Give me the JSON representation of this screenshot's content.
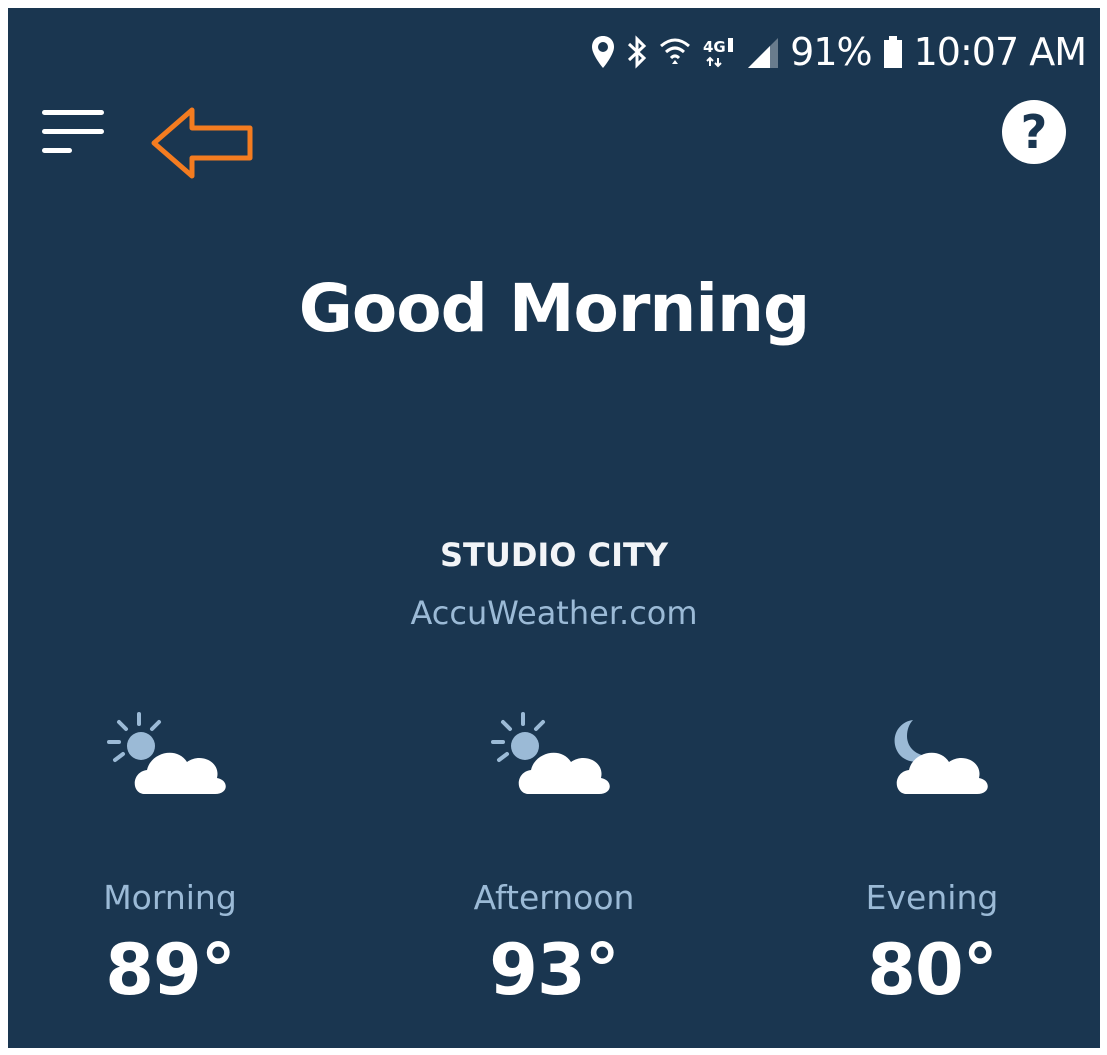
{
  "status_bar": {
    "battery_percent": "91%",
    "time": "10:07 AM",
    "icons": [
      "location-icon",
      "bluetooth-icon",
      "wifi-icon",
      "lte-icon",
      "signal-icon",
      "battery-icon"
    ]
  },
  "header": {
    "menu_icon": "hamburger-menu-icon",
    "help_icon": "help-icon",
    "help_label": "?",
    "annotation_icon": "arrow-left-outline",
    "annotation_color": "#f47c20"
  },
  "greeting": "Good Morning",
  "weather": {
    "location": "STUDIO CITY",
    "source": "AccuWeather.com",
    "forecast": [
      {
        "period": "Morning",
        "temp": "89°",
        "icon": "partly-sunny-icon"
      },
      {
        "period": "Afternoon",
        "temp": "93°",
        "icon": "partly-sunny-icon"
      },
      {
        "period": "Evening",
        "temp": "80°",
        "icon": "partly-cloudy-night-icon"
      }
    ]
  },
  "colors": {
    "background": "#1a3650",
    "accent_text": "#9bbad6",
    "annotation": "#f47c20"
  }
}
